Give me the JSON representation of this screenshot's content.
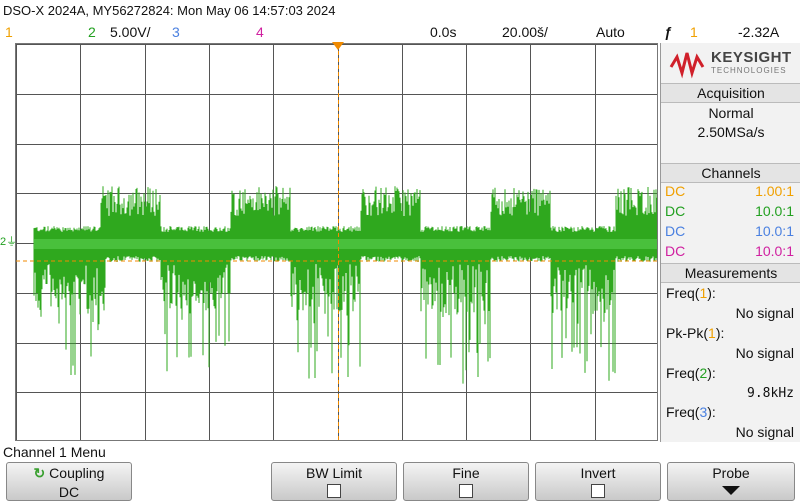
{
  "header": {
    "title": "DSO-X 2024A, MY56272824: Mon May 06 14:57:03 2024"
  },
  "status": {
    "ch1_num": "1",
    "ch2_num": "2",
    "ch2_scale": "5.00V/",
    "ch3_num": "3",
    "ch4_num": "4",
    "time_delay": "0.0s",
    "time_scale": "20.00š/",
    "trigger_mode": "Auto",
    "trigger_edge_symbol": "ƒ",
    "trigger_channel": "1",
    "trigger_level": "-2.32A"
  },
  "colors": {
    "ch1": "#f0a000",
    "ch2": "#22a020",
    "ch3": "#4a80e0",
    "ch4": "#d020a0",
    "grid": "#555555",
    "trace": "#2fa81e"
  },
  "panel": {
    "logo_brand": "KEYSIGHT",
    "logo_sub": "TECHNOLOGIES",
    "acq_title": "Acquisition",
    "acq_mode": "Normal",
    "acq_rate": "2.50MSa/s",
    "channels_title": "Channels",
    "channels": [
      {
        "coupling": "DC",
        "probe": "1.00:1"
      },
      {
        "coupling": "DC",
        "probe": "10.0:1"
      },
      {
        "coupling": "DC",
        "probe": "10.0:1"
      },
      {
        "coupling": "DC",
        "probe": "10.0:1"
      }
    ],
    "meas_title": "Measurements",
    "measurements": [
      {
        "name": "Freq",
        "ch": "1",
        "value": "No signal"
      },
      {
        "name": "Pk-Pk",
        "ch": "1",
        "value": "No signal"
      },
      {
        "name": "Freq",
        "ch": "2",
        "value": "9.8kHz"
      },
      {
        "name": "Freq",
        "ch": "3",
        "value": "No signal"
      }
    ]
  },
  "menu": {
    "title": "Channel 1 Menu",
    "coupling_label": "Coupling",
    "coupling_value": "DC",
    "bw_limit_label": "BW Limit",
    "fine_label": "Fine",
    "invert_label": "Invert",
    "probe_label": "Probe"
  },
  "signal": {
    "ch2_ground_marker": "2"
  }
}
